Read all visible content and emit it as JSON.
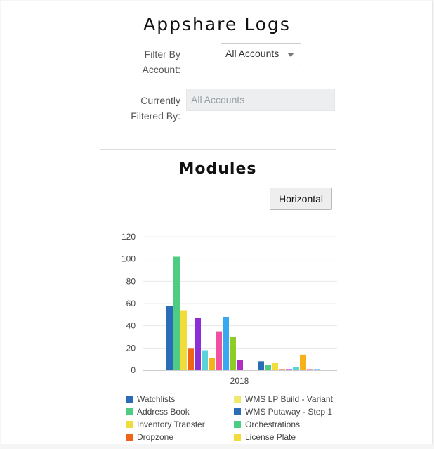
{
  "header": {
    "title": "Appshare Logs"
  },
  "filter": {
    "label_line1": "Filter By",
    "label_line2": "Account:",
    "selected": "All Accounts",
    "current_label_line1": "Currently",
    "current_label_line2": "Filtered By:",
    "current_value": "All Accounts"
  },
  "modules": {
    "title": "Modules",
    "orientation_button": "Horizontal"
  },
  "chart_data": {
    "type": "bar",
    "categories": [
      "2018"
    ],
    "ylim": [
      0,
      120
    ],
    "yticks": [
      0,
      20,
      40,
      60,
      80,
      100,
      120
    ],
    "grid": true,
    "legend_placement": "bottom",
    "series": [
      {
        "name": "Watchlists",
        "values": [
          58
        ],
        "color": "#2b6cb8"
      },
      {
        "name": "Address Book",
        "values": [
          102
        ],
        "color": "#4fcc84"
      },
      {
        "name": "Inventory Transfer",
        "values": [
          54
        ],
        "color": "#f2dc3c"
      },
      {
        "name": "Dropzone",
        "values": [
          20
        ],
        "color": "#f06418"
      },
      {
        "values": [
          47
        ],
        "color": "#8c2fd6"
      },
      {
        "values": [
          18
        ],
        "color": "#5ad4d8"
      },
      {
        "values": [
          11
        ],
        "color": "#f5b21a"
      },
      {
        "values": [
          35
        ],
        "color": "#f050a4"
      },
      {
        "values": [
          48
        ],
        "color": "#3aa8f0"
      },
      {
        "values": [
          30
        ],
        "color": "#8fcc28"
      },
      {
        "values": [
          9
        ],
        "color": "#b02ec0"
      },
      {
        "values": [
          0
        ],
        "color": "#5ac8f0"
      },
      {
        "values": [
          0
        ],
        "color": "#f0e870"
      },
      {
        "values": [
          8
        ],
        "color": "#2b6cb8"
      },
      {
        "values": [
          5
        ],
        "color": "#4fcc84"
      },
      {
        "values": [
          7
        ],
        "color": "#f2dc3c"
      },
      {
        "values": [
          1
        ],
        "color": "#f06418"
      },
      {
        "values": [
          1
        ],
        "color": "#8c2fd6"
      },
      {
        "values": [
          3
        ],
        "color": "#5ad4d8"
      },
      {
        "values": [
          14
        ],
        "color": "#f5b21a"
      },
      {
        "values": [
          1
        ],
        "color": "#f050a4"
      },
      {
        "values": [
          1
        ],
        "color": "#3aa8f0"
      }
    ],
    "legend": [
      {
        "name": "Watchlists",
        "color": "#2b6cb8"
      },
      {
        "name": "WMS LP Build - Variant",
        "color": "#f0e870"
      },
      {
        "name": "Address Book",
        "color": "#4fcc84"
      },
      {
        "name": "WMS Putaway - Step 1",
        "color": "#2b6cb8"
      },
      {
        "name": "Inventory Transfer",
        "color": "#f2dc3c"
      },
      {
        "name": "Orchestrations",
        "color": "#4fcc84"
      },
      {
        "name": "Dropzone",
        "color": "#f06418"
      },
      {
        "name": "License Plate",
        "color": "#f2dc3c"
      }
    ]
  }
}
